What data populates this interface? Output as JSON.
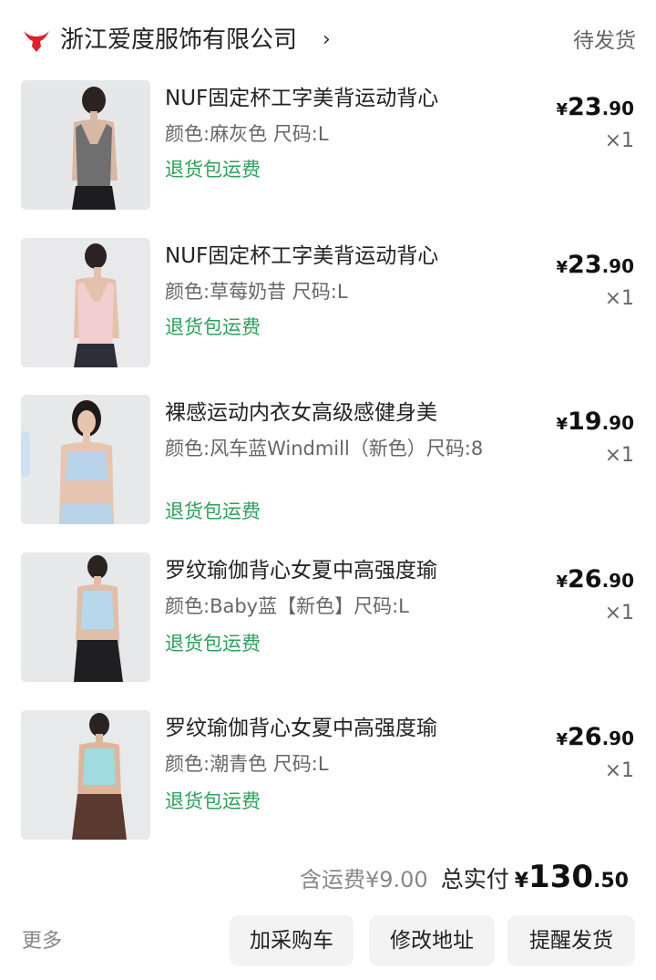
{
  "header": {
    "shop_name": "浙江爱度服饰有限公司",
    "chevron": "›",
    "status": "待发货",
    "logo_icon": "bull-head-icon",
    "logo_color": "#e0202a"
  },
  "items": [
    {
      "title": "NUF固定杯工字美背运动背心",
      "spec": "颜色:麻灰色 尺码:L",
      "ship_tag": "退货包运费",
      "price_currency": "¥",
      "price_int": "23",
      "price_dec": ".90",
      "qty": "×1",
      "thumb_color": "#6f6f70"
    },
    {
      "title": "NUF固定杯工字美背运动背心",
      "spec": "颜色:草莓奶昔 尺码:L",
      "ship_tag": "退货包运费",
      "price_currency": "¥",
      "price_int": "23",
      "price_dec": ".90",
      "qty": "×1",
      "thumb_color": "#f2cfcf"
    },
    {
      "title": "裸感运动内衣女高级感健身美",
      "spec": "颜色:风车蓝Windmill（新色）尺码:8",
      "ship_tag": "退货包运费",
      "price_currency": "¥",
      "price_int": "19",
      "price_dec": ".90",
      "qty": "×1",
      "thumb_color": "#b9d3ea"
    },
    {
      "title": "罗纹瑜伽背心女夏中高强度瑜",
      "spec": "颜色:Baby蓝【新色】尺码:L",
      "ship_tag": "退货包运费",
      "price_currency": "¥",
      "price_int": "26",
      "price_dec": ".90",
      "qty": "×1",
      "thumb_color": "#b6d8ea"
    },
    {
      "title": "罗纹瑜伽背心女夏中高强度瑜",
      "spec": "颜色:潮青色 尺码:L",
      "ship_tag": "退货包运费",
      "price_currency": "¥",
      "price_int": "26",
      "price_dec": ".90",
      "qty": "×1",
      "thumb_color": "#9fdbe0"
    }
  ],
  "summary": {
    "shipping_fee": "含运费¥9.00",
    "total_label": "总实付",
    "total_currency": "¥",
    "total_int": "130",
    "total_dec": ".50"
  },
  "footer": {
    "more": "更多",
    "buttons": [
      "加采购车",
      "修改地址",
      "提醒发货"
    ]
  },
  "colors": {
    "accent_green": "#2ea05a",
    "button_bg": "#f3f3f3"
  }
}
